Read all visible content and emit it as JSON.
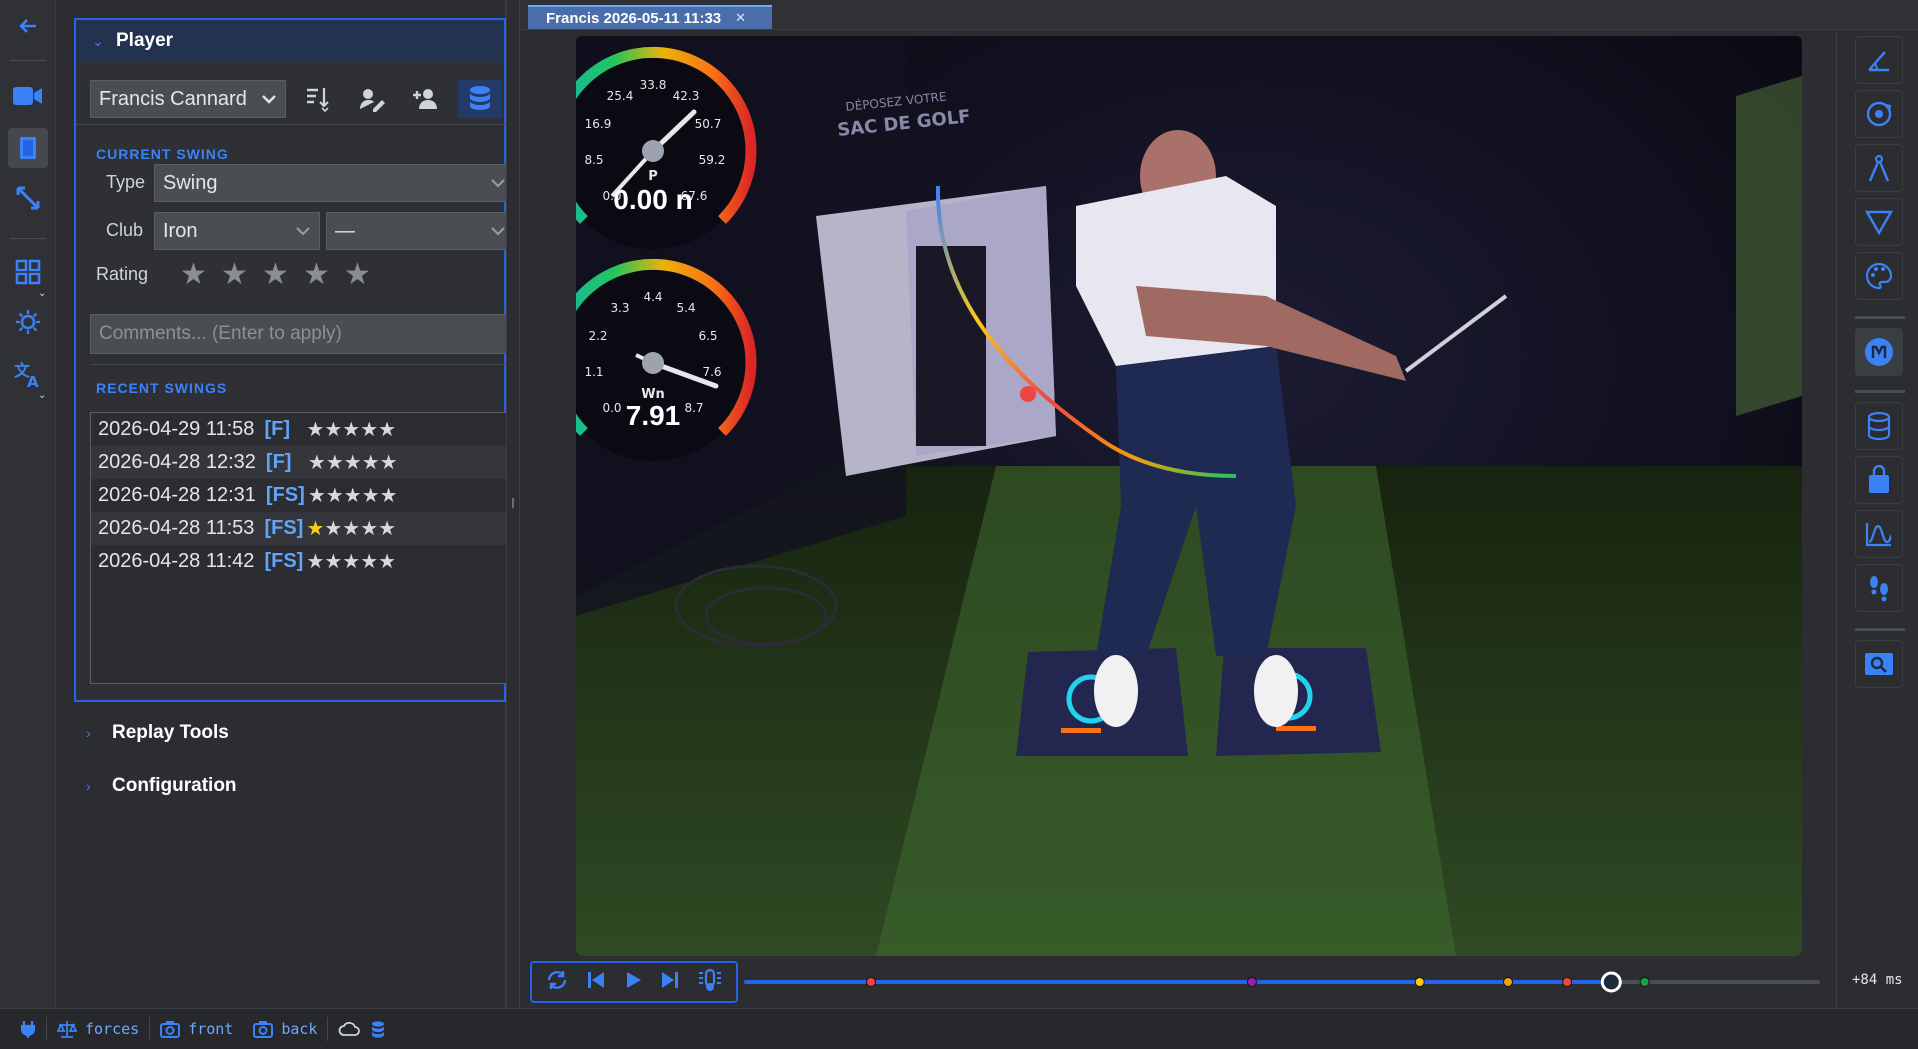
{
  "app": {
    "back_label": "←"
  },
  "player_panel": {
    "title": "Player",
    "player_name": "Francis Cannard",
    "current_swing_label": "CURRENT SWING",
    "type_label": "Type",
    "type_value": "Swing",
    "club_label": "Club",
    "club_value": "Iron",
    "club_sub_value": "—",
    "rating_label": "Rating",
    "rating_value": 0,
    "comments_placeholder": "Comments... (Enter to apply)",
    "recent_swings_label": "RECENT SWINGS",
    "recent_swings": [
      {
        "date": "2026-04-29 11:58",
        "tag": "[F]",
        "stars": "★★★★★",
        "rating": 0
      },
      {
        "date": "2026-04-28 12:32",
        "tag": "[F]",
        "stars": "★★★★★",
        "rating": 0
      },
      {
        "date": "2026-04-28 12:31",
        "tag": "[FS]",
        "stars": "★★★★★",
        "rating": 0
      },
      {
        "date": "2026-04-28 11:53",
        "tag": "[FS]",
        "stars_on": "★",
        "stars_off": "★★★★",
        "rating": 1
      },
      {
        "date": "2026-04-28 11:42",
        "tag": "[FS]",
        "stars": "★★★★★",
        "rating": 0
      }
    ]
  },
  "sections": {
    "replay_tools": "Replay Tools",
    "configuration": "Configuration"
  },
  "tab": {
    "label": "Francis 2026-05-11 11:33",
    "close": "✕"
  },
  "scene_text": {
    "sign_line1": "DÉPOSEZ VOTRE",
    "sign_line2": "SAC DE GOLF"
  },
  "gauge_top": {
    "ticks": [
      "0.0",
      "8.5",
      "16.9",
      "25.4",
      "33.8",
      "42.3",
      "50.7",
      "59.2",
      "67.6"
    ],
    "unit": "P",
    "value": "0.00 n"
  },
  "gauge_bottom": {
    "ticks": [
      "0.0",
      "1.1",
      "2.2",
      "3.3",
      "4.4",
      "5.4",
      "6.5",
      "7.6",
      "8.7"
    ],
    "unit": "Wn",
    "value": "7.91"
  },
  "timeline": {
    "timecode": "+84 ms",
    "markers": [
      {
        "color": "#ef4444",
        "pos": 0.118
      },
      {
        "color": "#a21caf",
        "pos": 0.472
      },
      {
        "color": "#facc15",
        "pos": 0.628
      },
      {
        "color": "#f59e0b",
        "pos": 0.71
      },
      {
        "color": "#ef4444",
        "pos": 0.765
      },
      {
        "color": "#16a34a",
        "pos": 0.837
      }
    ],
    "playhead": 0.806
  },
  "statusbar": {
    "forces": "forces",
    "front": "front",
    "back": "back"
  },
  "colors": {
    "accent": "#3b82f6",
    "panel_border": "#2563eb",
    "star_on": "#facc15"
  }
}
